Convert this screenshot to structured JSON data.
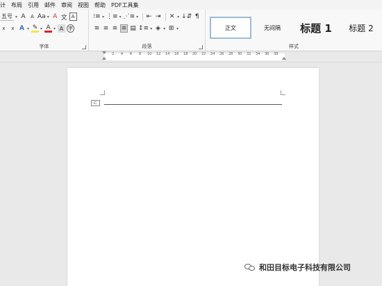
{
  "menu": {
    "items": [
      "计",
      "布局",
      "引用",
      "邮件",
      "审阅",
      "视图",
      "帮助",
      "PDF工具集"
    ]
  },
  "ribbon": {
    "font_group": {
      "label": "字体",
      "font_size_value": "五号",
      "row1_icons": [
        "A",
        "A",
        "Aa",
        "A",
        "文"
      ],
      "row2_icons": [
        "x",
        "x",
        "A",
        "A",
        "A"
      ]
    },
    "paragraph_group": {
      "label": "段落"
    },
    "styles_group": {
      "label": "样式",
      "styles": [
        "正文",
        "无间隔",
        "标题 1",
        "标题 2"
      ]
    }
  },
  "ruler": {
    "ticks": [
      "2",
      "4",
      "6",
      "8",
      "10",
      "12",
      "14",
      "16",
      "18",
      "20",
      "22",
      "24",
      "26",
      "28",
      "30",
      "32",
      "34",
      "36",
      "38"
    ]
  },
  "document": {
    "anchor_glyph": "⊏"
  },
  "watermark": {
    "text": "和田目标电子科技有限公司"
  }
}
